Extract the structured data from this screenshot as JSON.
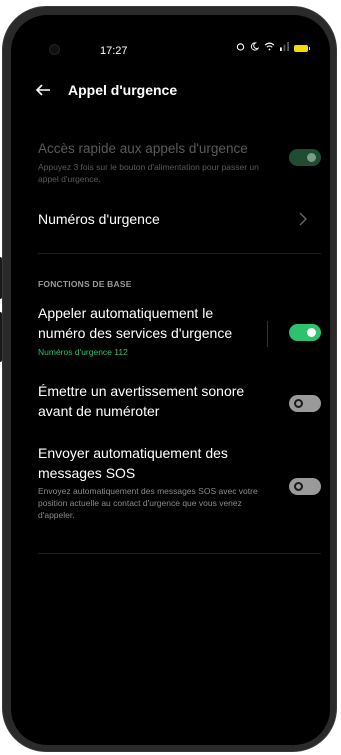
{
  "status_bar": {
    "time": "17:27",
    "icons": [
      "alarm-icon",
      "do-not-disturb-icon",
      "wifi-icon",
      "signal-icon",
      "battery-icon"
    ]
  },
  "header": {
    "title": "Appel d'urgence"
  },
  "quick_access": {
    "title": "Accès rapide aux appels d'urgence",
    "subtitle": "Appuyez 3 fois sur le bouton d'alimentation pour passer un appel d'urgence.",
    "enabled": true,
    "disabled_row": true
  },
  "emergency_numbers": {
    "label": "Numéros d'urgence"
  },
  "section": {
    "label": "FONCTIONS DE BASE"
  },
  "auto_call": {
    "title": "Appeler automatiquement le numéro des services d'urgence",
    "subtitle": "Numéros d'urgence 112",
    "enabled": true
  },
  "sound_warning": {
    "title": "Émettre un avertissement sonore avant de numéroter",
    "enabled": false
  },
  "sos_messages": {
    "title": "Envoyer automatiquement des messages SOS",
    "subtitle": "Envoyez automatiquement des messages SOS avec votre position actuelle au contact d'urgence que vous venez d'appeler.",
    "enabled": false
  },
  "colors": {
    "accent": "#2ec16e",
    "background": "#000000",
    "toggle_off": "#9a9a9a"
  }
}
